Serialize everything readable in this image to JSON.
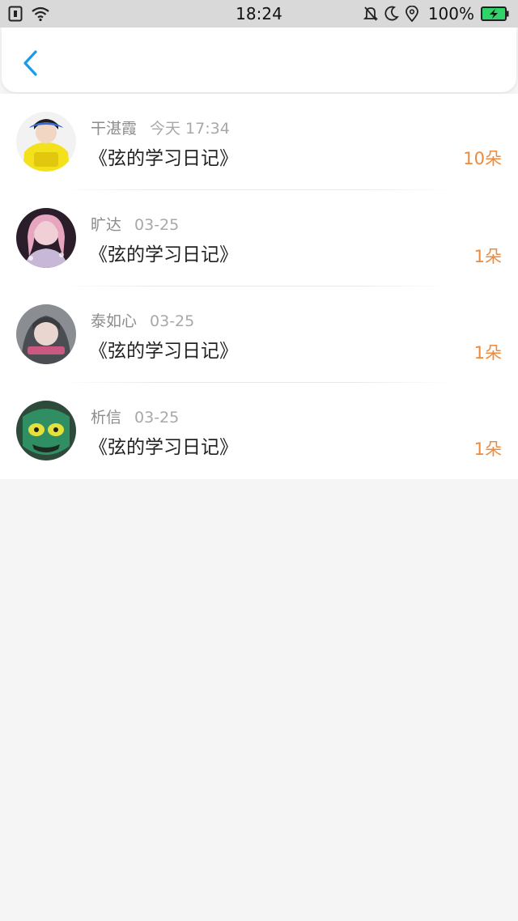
{
  "status_bar": {
    "time": "18:24",
    "battery": "100%",
    "icons": [
      "sim-icon",
      "wifi-icon",
      "mute-icon",
      "moon-icon",
      "location-icon",
      "battery-charging-icon"
    ]
  },
  "nav": {
    "back_icon": "chevron-left-icon",
    "accent_color": "#1a9be6"
  },
  "items": [
    {
      "name": "干湛霞",
      "date": "今天 17:34",
      "title": "《弦的学习日记》",
      "count": "10朵"
    },
    {
      "name": "旷达",
      "date": "03-25",
      "title": "《弦的学习日记》",
      "count": "1朵"
    },
    {
      "name": "泰如心",
      "date": "03-25",
      "title": "《弦的学习日记》",
      "count": "1朵"
    },
    {
      "name": "析信",
      "date": "03-25",
      "title": "《弦的学习日记》",
      "count": "1朵"
    }
  ],
  "colors": {
    "count": "#ee8a3c",
    "status_bar_bg": "#d9d9d9",
    "page_bg": "#f5f5f5"
  }
}
